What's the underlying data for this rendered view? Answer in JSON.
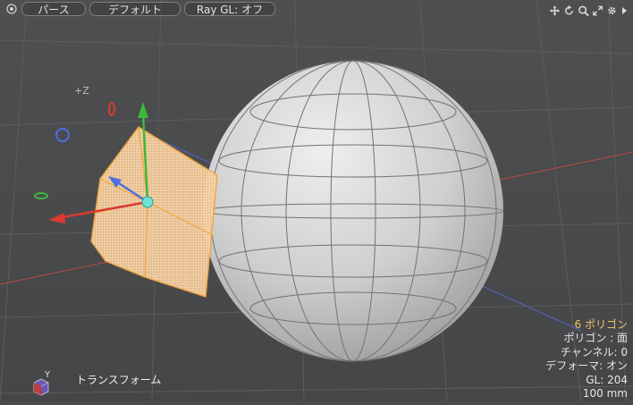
{
  "toolbar": {
    "perspective_label": "パース",
    "default_label": "デフォルト",
    "raygl_label": "Ray GL: オフ"
  },
  "viewport_tools": [
    "move-view-icon",
    "rotate-view-icon",
    "zoom-view-icon",
    "maximize-view-icon",
    "settings-gear-icon",
    "expand-arrow-icon"
  ],
  "scene": {
    "axis_label": "+Z",
    "corner_axis_label": "Y"
  },
  "info_panel": {
    "polygons": "6 ポリゴン",
    "polygon_mode": "ポリゴン : 面",
    "channels": "チャンネル: 0",
    "deformer": "デフォーマ: オン",
    "gl": "GL: 204",
    "scale": "100 mm"
  },
  "status": {
    "tool_name": "トランスフォーム"
  },
  "colors": {
    "background": "#4a4b4d",
    "selection": "#f2a73b",
    "x_axis": "#d93a32",
    "y_axis": "#3cb83b",
    "z_axis": "#4f6fe0",
    "highlight_text": "#f0c36e"
  }
}
